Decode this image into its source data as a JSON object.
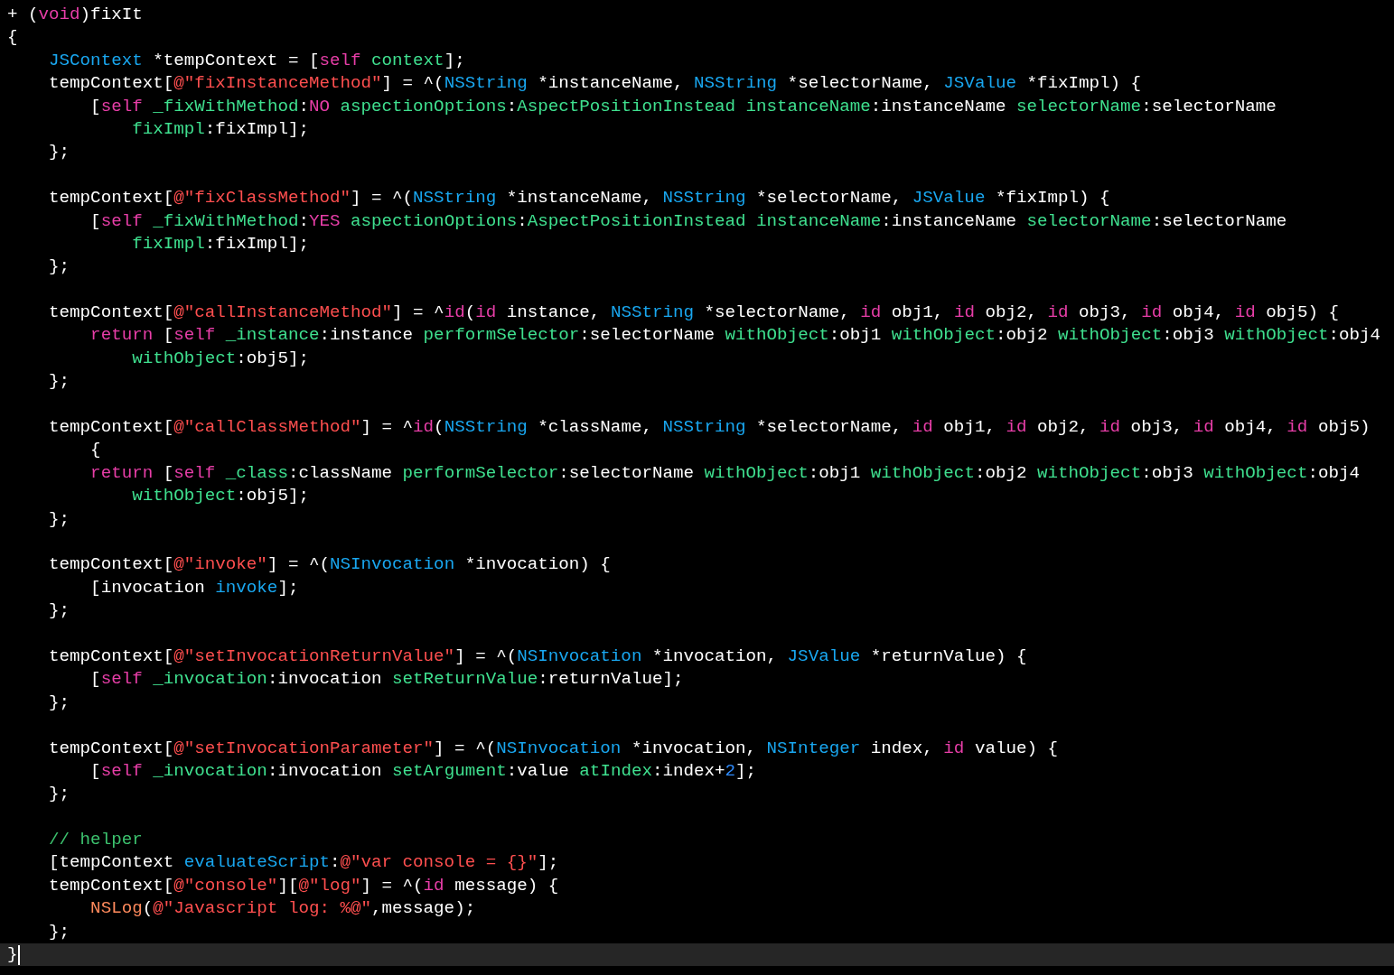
{
  "editor": {
    "lines": [
      {
        "kind": "code",
        "tokens": [
          {
            "kind": "plain",
            "text": "+ ("
          },
          {
            "kind": "kw",
            "text": "void"
          },
          {
            "kind": "plain",
            "text": ")fixIt"
          }
        ]
      },
      {
        "kind": "code",
        "tokens": [
          {
            "kind": "plain",
            "text": "{"
          }
        ]
      },
      {
        "kind": "code",
        "tokens": [
          {
            "kind": "type",
            "text": "    JSContext"
          },
          {
            "kind": "plain",
            "text": " *tempContext = ["
          },
          {
            "kind": "kw",
            "text": "self"
          },
          {
            "kind": "meth",
            "text": " context"
          },
          {
            "kind": "plain",
            "text": "];"
          }
        ]
      },
      {
        "kind": "code",
        "tokens": [
          {
            "kind": "plain",
            "text": "    tempContext["
          },
          {
            "kind": "str",
            "text": "@\"fixInstanceMethod\""
          },
          {
            "kind": "plain",
            "text": "] = ^("
          },
          {
            "kind": "type",
            "text": "NSString"
          },
          {
            "kind": "plain",
            "text": " *instanceName, "
          },
          {
            "kind": "type",
            "text": "NSString"
          },
          {
            "kind": "plain",
            "text": " *selectorName, "
          },
          {
            "kind": "type",
            "text": "JSValue"
          },
          {
            "kind": "plain",
            "text": " *fixImpl) {"
          }
        ]
      },
      {
        "kind": "code",
        "tokens": [
          {
            "kind": "plain",
            "text": "        ["
          },
          {
            "kind": "kw",
            "text": "self"
          },
          {
            "kind": "meth",
            "text": " _fixWithMethod"
          },
          {
            "kind": "plain",
            "text": ":"
          },
          {
            "kind": "kw",
            "text": "NO"
          },
          {
            "kind": "meth",
            "text": " aspectionOptions"
          },
          {
            "kind": "plain",
            "text": ":"
          },
          {
            "kind": "meth",
            "text": "AspectPositionInstead"
          },
          {
            "kind": "meth",
            "text": " instanceName"
          },
          {
            "kind": "plain",
            "text": ":instanceName "
          },
          {
            "kind": "meth",
            "text": "selectorName"
          },
          {
            "kind": "plain",
            "text": ":selectorName"
          }
        ]
      },
      {
        "kind": "code",
        "tokens": [
          {
            "kind": "meth",
            "text": "            fixImpl"
          },
          {
            "kind": "plain",
            "text": ":fixImpl];"
          }
        ]
      },
      {
        "kind": "code",
        "tokens": [
          {
            "kind": "plain",
            "text": "    };"
          }
        ]
      },
      {
        "kind": "blank"
      },
      {
        "kind": "code",
        "tokens": [
          {
            "kind": "plain",
            "text": "    tempContext["
          },
          {
            "kind": "str",
            "text": "@\"fixClassMethod\""
          },
          {
            "kind": "plain",
            "text": "] = ^("
          },
          {
            "kind": "type",
            "text": "NSString"
          },
          {
            "kind": "plain",
            "text": " *instanceName, "
          },
          {
            "kind": "type",
            "text": "NSString"
          },
          {
            "kind": "plain",
            "text": " *selectorName, "
          },
          {
            "kind": "type",
            "text": "JSValue"
          },
          {
            "kind": "plain",
            "text": " *fixImpl) {"
          }
        ]
      },
      {
        "kind": "code",
        "tokens": [
          {
            "kind": "plain",
            "text": "        ["
          },
          {
            "kind": "kw",
            "text": "self"
          },
          {
            "kind": "meth",
            "text": " _fixWithMethod"
          },
          {
            "kind": "plain",
            "text": ":"
          },
          {
            "kind": "kw",
            "text": "YES"
          },
          {
            "kind": "meth",
            "text": " aspectionOptions"
          },
          {
            "kind": "plain",
            "text": ":"
          },
          {
            "kind": "meth",
            "text": "AspectPositionInstead"
          },
          {
            "kind": "meth",
            "text": " instanceName"
          },
          {
            "kind": "plain",
            "text": ":instanceName "
          },
          {
            "kind": "meth",
            "text": "selectorName"
          },
          {
            "kind": "plain",
            "text": ":selectorName"
          }
        ]
      },
      {
        "kind": "code",
        "tokens": [
          {
            "kind": "meth",
            "text": "            fixImpl"
          },
          {
            "kind": "plain",
            "text": ":fixImpl];"
          }
        ]
      },
      {
        "kind": "code",
        "tokens": [
          {
            "kind": "plain",
            "text": "    };"
          }
        ]
      },
      {
        "kind": "blank"
      },
      {
        "kind": "code",
        "tokens": [
          {
            "kind": "plain",
            "text": "    tempContext["
          },
          {
            "kind": "str",
            "text": "@\"callInstanceMethod\""
          },
          {
            "kind": "plain",
            "text": "] = ^"
          },
          {
            "kind": "kw",
            "text": "id"
          },
          {
            "kind": "plain",
            "text": "("
          },
          {
            "kind": "kw",
            "text": "id"
          },
          {
            "kind": "plain",
            "text": " instance, "
          },
          {
            "kind": "type",
            "text": "NSString"
          },
          {
            "kind": "plain",
            "text": " *selectorName, "
          },
          {
            "kind": "kw",
            "text": "id"
          },
          {
            "kind": "plain",
            "text": " obj1, "
          },
          {
            "kind": "kw",
            "text": "id"
          },
          {
            "kind": "plain",
            "text": " obj2, "
          },
          {
            "kind": "kw",
            "text": "id"
          },
          {
            "kind": "plain",
            "text": " obj3, "
          },
          {
            "kind": "kw",
            "text": "id"
          },
          {
            "kind": "plain",
            "text": " obj4, "
          },
          {
            "kind": "kw",
            "text": "id"
          },
          {
            "kind": "plain",
            "text": " obj5) {"
          }
        ]
      },
      {
        "kind": "code",
        "tokens": [
          {
            "kind": "kw",
            "text": "        return"
          },
          {
            "kind": "plain",
            "text": " ["
          },
          {
            "kind": "kw",
            "text": "self"
          },
          {
            "kind": "meth",
            "text": " _instance"
          },
          {
            "kind": "plain",
            "text": ":instance "
          },
          {
            "kind": "meth",
            "text": "performSelector"
          },
          {
            "kind": "plain",
            "text": ":selectorName "
          },
          {
            "kind": "meth",
            "text": "withObject"
          },
          {
            "kind": "plain",
            "text": ":obj1 "
          },
          {
            "kind": "meth",
            "text": "withObject"
          },
          {
            "kind": "plain",
            "text": ":obj2 "
          },
          {
            "kind": "meth",
            "text": "withObject"
          },
          {
            "kind": "plain",
            "text": ":obj3 "
          },
          {
            "kind": "meth",
            "text": "withObject"
          },
          {
            "kind": "plain",
            "text": ":obj4"
          }
        ]
      },
      {
        "kind": "code",
        "tokens": [
          {
            "kind": "meth",
            "text": "            withObject"
          },
          {
            "kind": "plain",
            "text": ":obj5];"
          }
        ]
      },
      {
        "kind": "code",
        "tokens": [
          {
            "kind": "plain",
            "text": "    };"
          }
        ]
      },
      {
        "kind": "blank"
      },
      {
        "kind": "code",
        "tokens": [
          {
            "kind": "plain",
            "text": "    tempContext["
          },
          {
            "kind": "str",
            "text": "@\"callClassMethod\""
          },
          {
            "kind": "plain",
            "text": "] = ^"
          },
          {
            "kind": "kw",
            "text": "id"
          },
          {
            "kind": "plain",
            "text": "("
          },
          {
            "kind": "type",
            "text": "NSString"
          },
          {
            "kind": "plain",
            "text": " *className, "
          },
          {
            "kind": "type",
            "text": "NSString"
          },
          {
            "kind": "plain",
            "text": " *selectorName, "
          },
          {
            "kind": "kw",
            "text": "id"
          },
          {
            "kind": "plain",
            "text": " obj1, "
          },
          {
            "kind": "kw",
            "text": "id"
          },
          {
            "kind": "plain",
            "text": " obj2, "
          },
          {
            "kind": "kw",
            "text": "id"
          },
          {
            "kind": "plain",
            "text": " obj3, "
          },
          {
            "kind": "kw",
            "text": "id"
          },
          {
            "kind": "plain",
            "text": " obj4, "
          },
          {
            "kind": "kw",
            "text": "id"
          },
          {
            "kind": "plain",
            "text": " obj5)"
          }
        ]
      },
      {
        "kind": "code",
        "tokens": [
          {
            "kind": "plain",
            "text": "        {"
          }
        ]
      },
      {
        "kind": "code",
        "tokens": [
          {
            "kind": "kw",
            "text": "        return"
          },
          {
            "kind": "plain",
            "text": " ["
          },
          {
            "kind": "kw",
            "text": "self"
          },
          {
            "kind": "meth",
            "text": " _class"
          },
          {
            "kind": "plain",
            "text": ":className "
          },
          {
            "kind": "meth",
            "text": "performSelector"
          },
          {
            "kind": "plain",
            "text": ":selectorName "
          },
          {
            "kind": "meth",
            "text": "withObject"
          },
          {
            "kind": "plain",
            "text": ":obj1 "
          },
          {
            "kind": "meth",
            "text": "withObject"
          },
          {
            "kind": "plain",
            "text": ":obj2 "
          },
          {
            "kind": "meth",
            "text": "withObject"
          },
          {
            "kind": "plain",
            "text": ":obj3 "
          },
          {
            "kind": "meth",
            "text": "withObject"
          },
          {
            "kind": "plain",
            "text": ":obj4"
          }
        ]
      },
      {
        "kind": "code",
        "tokens": [
          {
            "kind": "meth",
            "text": "            withObject"
          },
          {
            "kind": "plain",
            "text": ":obj5];"
          }
        ]
      },
      {
        "kind": "code",
        "tokens": [
          {
            "kind": "plain",
            "text": "    };"
          }
        ]
      },
      {
        "kind": "blank"
      },
      {
        "kind": "code",
        "tokens": [
          {
            "kind": "plain",
            "text": "    tempContext["
          },
          {
            "kind": "str",
            "text": "@\"invoke\""
          },
          {
            "kind": "plain",
            "text": "] = ^("
          },
          {
            "kind": "type",
            "text": "NSInvocation"
          },
          {
            "kind": "plain",
            "text": " *invocation) {"
          }
        ]
      },
      {
        "kind": "code",
        "tokens": [
          {
            "kind": "plain",
            "text": "        [invocation "
          },
          {
            "kind": "api",
            "text": "invoke"
          },
          {
            "kind": "plain",
            "text": "];"
          }
        ]
      },
      {
        "kind": "code",
        "tokens": [
          {
            "kind": "plain",
            "text": "    };"
          }
        ]
      },
      {
        "kind": "blank"
      },
      {
        "kind": "code",
        "tokens": [
          {
            "kind": "plain",
            "text": "    tempContext["
          },
          {
            "kind": "str",
            "text": "@\"setInvocationReturnValue\""
          },
          {
            "kind": "plain",
            "text": "] = ^("
          },
          {
            "kind": "type",
            "text": "NSInvocation"
          },
          {
            "kind": "plain",
            "text": " *invocation, "
          },
          {
            "kind": "type",
            "text": "JSValue"
          },
          {
            "kind": "plain",
            "text": " *returnValue) {"
          }
        ]
      },
      {
        "kind": "code",
        "tokens": [
          {
            "kind": "plain",
            "text": "        ["
          },
          {
            "kind": "kw",
            "text": "self"
          },
          {
            "kind": "meth",
            "text": " _invocation"
          },
          {
            "kind": "plain",
            "text": ":invocation "
          },
          {
            "kind": "meth",
            "text": "setReturnValue"
          },
          {
            "kind": "plain",
            "text": ":returnValue];"
          }
        ]
      },
      {
        "kind": "code",
        "tokens": [
          {
            "kind": "plain",
            "text": "    };"
          }
        ]
      },
      {
        "kind": "blank"
      },
      {
        "kind": "code",
        "tokens": [
          {
            "kind": "plain",
            "text": "    tempContext["
          },
          {
            "kind": "str",
            "text": "@\"setInvocationParameter\""
          },
          {
            "kind": "plain",
            "text": "] = ^("
          },
          {
            "kind": "type",
            "text": "NSInvocation"
          },
          {
            "kind": "plain",
            "text": " *invocation, "
          },
          {
            "kind": "type",
            "text": "NSInteger"
          },
          {
            "kind": "plain",
            "text": " index, "
          },
          {
            "kind": "kw",
            "text": "id"
          },
          {
            "kind": "plain",
            "text": " value) {"
          }
        ]
      },
      {
        "kind": "code",
        "tokens": [
          {
            "kind": "plain",
            "text": "        ["
          },
          {
            "kind": "kw",
            "text": "self"
          },
          {
            "kind": "meth",
            "text": " _invocation"
          },
          {
            "kind": "plain",
            "text": ":invocation "
          },
          {
            "kind": "meth",
            "text": "setArgument"
          },
          {
            "kind": "plain",
            "text": ":value "
          },
          {
            "kind": "meth",
            "text": "atIndex"
          },
          {
            "kind": "plain",
            "text": ":index+"
          },
          {
            "kind": "num",
            "text": "2"
          },
          {
            "kind": "plain",
            "text": "];"
          }
        ]
      },
      {
        "kind": "code",
        "tokens": [
          {
            "kind": "plain",
            "text": "    };"
          }
        ]
      },
      {
        "kind": "blank"
      },
      {
        "kind": "code",
        "tokens": [
          {
            "kind": "comment",
            "text": "    // helper"
          }
        ]
      },
      {
        "kind": "code",
        "tokens": [
          {
            "kind": "plain",
            "text": "    [tempContext "
          },
          {
            "kind": "api",
            "text": "evaluateScript"
          },
          {
            "kind": "plain",
            "text": ":"
          },
          {
            "kind": "str",
            "text": "@\"var console = {}\""
          },
          {
            "kind": "plain",
            "text": "];"
          }
        ]
      },
      {
        "kind": "code",
        "tokens": [
          {
            "kind": "plain",
            "text": "    tempContext["
          },
          {
            "kind": "str",
            "text": "@\"console\""
          },
          {
            "kind": "plain",
            "text": "]["
          },
          {
            "kind": "str",
            "text": "@\"log\""
          },
          {
            "kind": "plain",
            "text": "] = ^("
          },
          {
            "kind": "kw",
            "text": "id"
          },
          {
            "kind": "plain",
            "text": " message) {"
          }
        ]
      },
      {
        "kind": "code",
        "tokens": [
          {
            "kind": "func",
            "text": "        NSLog"
          },
          {
            "kind": "plain",
            "text": "("
          },
          {
            "kind": "str",
            "text": "@\"Javascript log: %@\""
          },
          {
            "kind": "plain",
            "text": ",message);"
          }
        ]
      },
      {
        "kind": "code",
        "tokens": [
          {
            "kind": "plain",
            "text": "    };"
          }
        ]
      },
      {
        "kind": "current",
        "tokens": [
          {
            "kind": "plain",
            "text": "}"
          }
        ]
      }
    ]
  }
}
